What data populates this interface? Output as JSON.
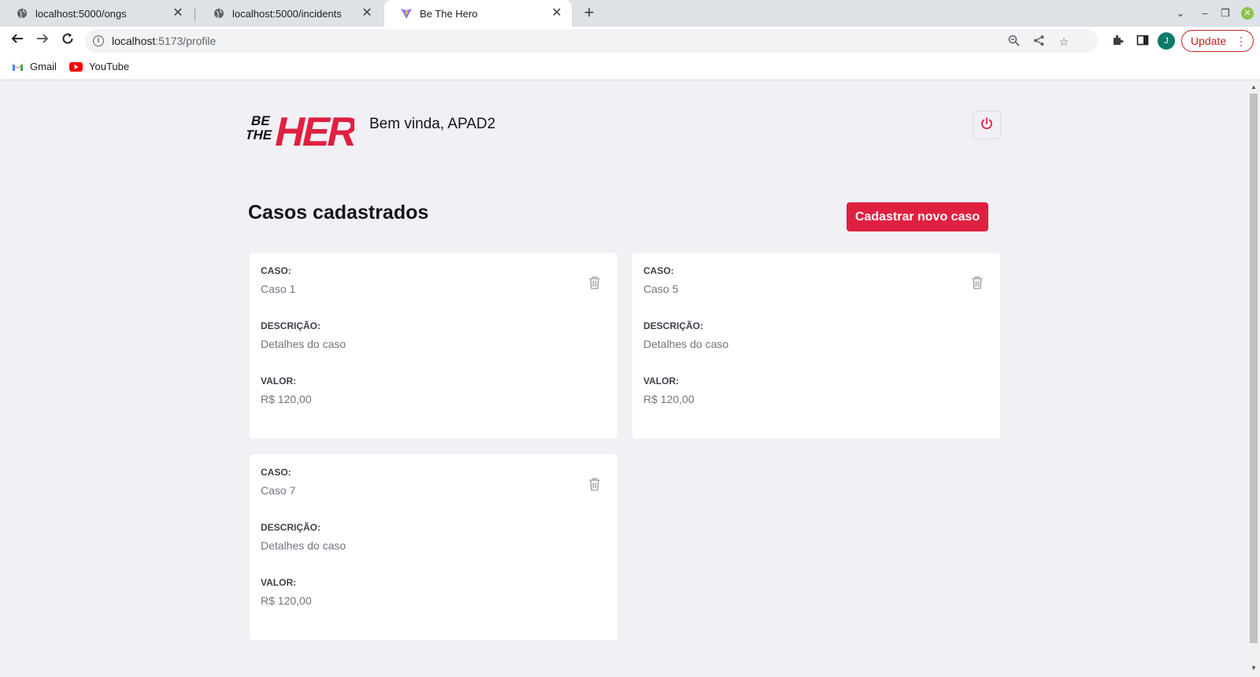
{
  "browser": {
    "tabs": [
      {
        "title": "localhost:5000/ongs",
        "close": "✕"
      },
      {
        "title": "localhost:5000/incidents",
        "close": "✕"
      },
      {
        "title": "Be The Hero",
        "close": "✕"
      }
    ],
    "new_tab": "+",
    "address": {
      "host": "localhost",
      "path": ":5173/profile"
    },
    "update_label": "Update",
    "avatar_letter": "J",
    "bookmarks": [
      {
        "label": "Gmail",
        "icon": "gmail-icon"
      },
      {
        "label": "YouTube",
        "icon": "youtube-icon"
      }
    ]
  },
  "header": {
    "logo_alt": "Be The Hero",
    "greeting": "Bem vinda, APAD2",
    "logout_icon": "power-icon"
  },
  "main": {
    "title": "Casos cadastrados",
    "new_case_label": "Cadastrar novo caso",
    "field_labels": {
      "case": "CASO:",
      "description": "DESCRIÇÃO:",
      "value": "VALOR:"
    },
    "incidents": [
      {
        "case": "Caso 1",
        "description": "Detalhes do caso",
        "value": "R$ 120,00"
      },
      {
        "case": "Caso 5",
        "description": "Detalhes do caso",
        "value": "R$ 120,00"
      },
      {
        "case": "Caso 7",
        "description": "Detalhes do caso",
        "value": "R$ 120,00"
      }
    ]
  },
  "colors": {
    "accent": "#e02041",
    "background": "#f0f0f5",
    "card": "#ffffff"
  }
}
